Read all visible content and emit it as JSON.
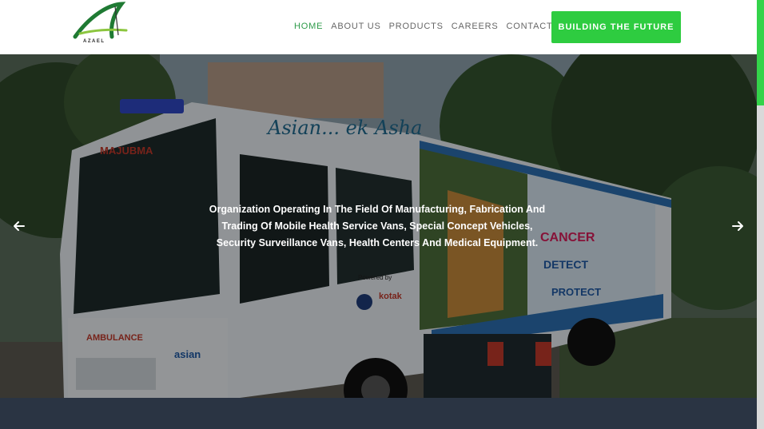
{
  "brand": {
    "logo_text": "AZAEL"
  },
  "nav": {
    "items": [
      {
        "label": "HOME",
        "active": true
      },
      {
        "label": "ABOUT US",
        "active": false
      },
      {
        "label": "PRODUCTS",
        "active": false
      },
      {
        "label": "CAREERS",
        "active": false
      },
      {
        "label": "CONTACT US",
        "active": false
      }
    ],
    "cta_label": "BUILDING THE FUTURE"
  },
  "hero": {
    "caption_lines": [
      "Organization Operating In The Field Of Manufacturing, Fabrication And",
      "Trading Of Mobile Health Service Vans, Special Concept Vehicles,",
      "Security Surveillance Vans, Health Centers And Medical Equipment."
    ],
    "image_text": {
      "van_script": "Asian... ek Asha",
      "windshield": "MAJUBMA",
      "ambulance": "AMBULANCE",
      "asian_logo": "asian",
      "powered_by": "Powered by",
      "kotak": "kotak",
      "cancer": "CANCER",
      "detect": "DETECT",
      "protect": "PROTECT"
    },
    "prev_icon": "arrow-left-icon",
    "next_icon": "arrow-right-icon"
  },
  "colors": {
    "accent": "#2ecc40",
    "nav_active": "#2e9b4a",
    "band": "#2a3443"
  }
}
